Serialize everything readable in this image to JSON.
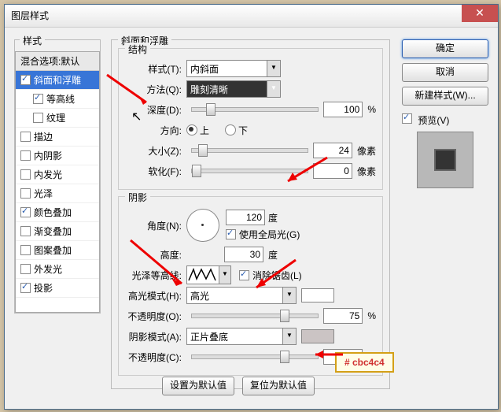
{
  "title": "图层样式",
  "sidebar": {
    "label": "样式",
    "items": [
      {
        "label": "混合选项:默认",
        "checked": null,
        "header": true
      },
      {
        "label": "斜面和浮雕",
        "checked": true,
        "selected": true
      },
      {
        "label": "等高线",
        "checked": true,
        "indent": true
      },
      {
        "label": "纹理",
        "checked": false,
        "indent": true
      },
      {
        "label": "描边",
        "checked": false
      },
      {
        "label": "内阴影",
        "checked": false
      },
      {
        "label": "内发光",
        "checked": false
      },
      {
        "label": "光泽",
        "checked": false
      },
      {
        "label": "颜色叠加",
        "checked": true
      },
      {
        "label": "渐变叠加",
        "checked": false
      },
      {
        "label": "图案叠加",
        "checked": false
      },
      {
        "label": "外发光",
        "checked": false
      },
      {
        "label": "投影",
        "checked": true
      }
    ]
  },
  "bevel": {
    "group_title": "斜面和浮雕",
    "structure_title": "结构",
    "style_label": "样式(T):",
    "style_value": "内斜面",
    "method_label": "方法(Q):",
    "method_value": "雕刻清晰",
    "depth_label": "深度(D):",
    "depth_value": "100",
    "pct": "%",
    "direction_label": "方向:",
    "dir_up": "上",
    "dir_down": "下",
    "size_label": "大小(Z):",
    "size_value": "24",
    "px": "像素",
    "soften_label": "软化(F):",
    "soften_value": "0"
  },
  "shading": {
    "group_title": "阴影",
    "angle_label": "角度(N):",
    "angle_value": "120",
    "deg": "度",
    "global_label": "使用全局光(G)",
    "altitude_label": "高度:",
    "altitude_value": "30",
    "contour_label": "光泽等高线:",
    "antialias_label": "消除锯齿(L)",
    "highlight_mode_label": "高光模式(H):",
    "highlight_mode_value": "高光",
    "opacity1_label": "不透明度(O):",
    "opacity1_value": "75",
    "shadow_mode_label": "阴影模式(A):",
    "shadow_mode_value": "正片叠底",
    "opacity2_label": "不透明度(C):",
    "opacity2_value": "75"
  },
  "buttons": {
    "ok": "确定",
    "cancel": "取消",
    "newstyle": "新建样式(W)...",
    "preview": "预览(V)",
    "defaults": "设置为默认值",
    "reset": "复位为默认值"
  },
  "note": "# cbc4c4"
}
